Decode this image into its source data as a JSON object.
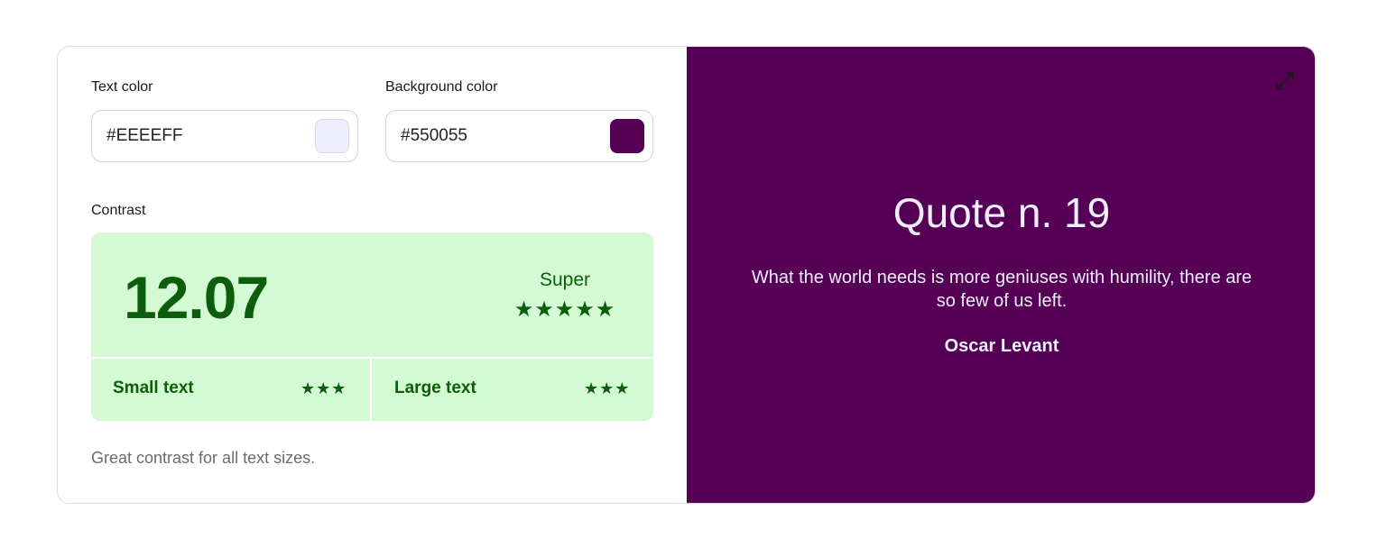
{
  "inputs": {
    "text_color": {
      "label": "Text color",
      "value": "#EEEEFF",
      "swatch": "#eeeeff"
    },
    "background_color": {
      "label": "Background color",
      "value": "#550055",
      "swatch": "#550055"
    }
  },
  "contrast": {
    "label": "Contrast",
    "ratio": "12.07",
    "rating": "Super",
    "rating_stars": "★★★★★",
    "small_text": {
      "label": "Small text",
      "stars": "★★★"
    },
    "large_text": {
      "label": "Large text",
      "stars": "★★★"
    },
    "summary": "Great contrast for all text sizes.",
    "colors": {
      "pass_bg": "#d3fad2",
      "pass_fg": "#0c5e0c"
    }
  },
  "preview": {
    "title": "Quote n. 19",
    "quote": "What the world needs is more geniuses with humility, there are so few of us left.",
    "author": "Oscar Levant",
    "expand_icon": "expand-icon"
  }
}
